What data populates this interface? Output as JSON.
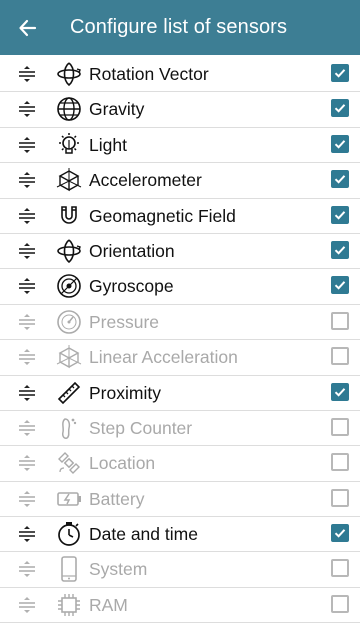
{
  "header": {
    "title": "Configure list of sensors",
    "back_icon": "arrow-left-icon",
    "color": "#3d7e94"
  },
  "accent": "#2f7a93",
  "sensors": [
    {
      "label": "Rotation Vector",
      "icon": "rotation-icon",
      "enabled": true,
      "checked": true
    },
    {
      "label": "Gravity",
      "icon": "globe-icon",
      "enabled": true,
      "checked": true
    },
    {
      "label": "Light",
      "icon": "bulb-icon",
      "enabled": true,
      "checked": true
    },
    {
      "label": "Accelerometer",
      "icon": "cube-axes-icon",
      "enabled": true,
      "checked": true
    },
    {
      "label": "Geomagnetic Field",
      "icon": "magnet-icon",
      "enabled": true,
      "checked": true
    },
    {
      "label": "Orientation",
      "icon": "rotation-icon",
      "enabled": true,
      "checked": true
    },
    {
      "label": "Gyroscope",
      "icon": "gyroscope-icon",
      "enabled": true,
      "checked": true
    },
    {
      "label": "Pressure",
      "icon": "gauge-icon",
      "enabled": false,
      "checked": false
    },
    {
      "label": "Linear Acceleration",
      "icon": "cube-axes-icon",
      "enabled": false,
      "checked": false
    },
    {
      "label": "Proximity",
      "icon": "ruler-icon",
      "enabled": true,
      "checked": true
    },
    {
      "label": "Step Counter",
      "icon": "footprint-icon",
      "enabled": false,
      "checked": false
    },
    {
      "label": "Location",
      "icon": "satellite-icon",
      "enabled": false,
      "checked": false
    },
    {
      "label": "Battery",
      "icon": "battery-icon",
      "enabled": false,
      "checked": false
    },
    {
      "label": "Date and time",
      "icon": "stopwatch-icon",
      "enabled": true,
      "checked": true
    },
    {
      "label": "System",
      "icon": "phone-icon",
      "enabled": false,
      "checked": false
    },
    {
      "label": "RAM",
      "icon": "chip-icon",
      "enabled": false,
      "checked": false
    }
  ]
}
